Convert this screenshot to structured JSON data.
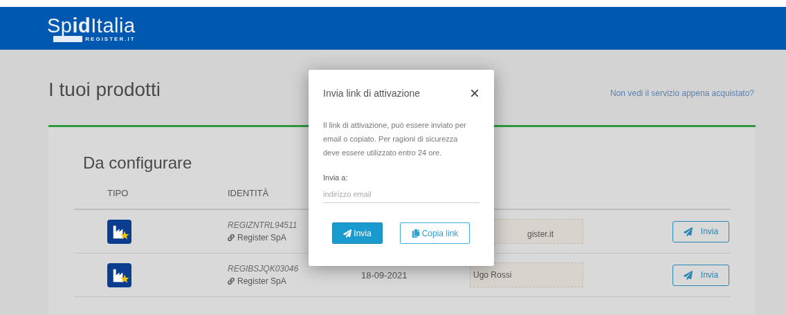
{
  "header": {
    "logo": "Sp**id**Italia",
    "logo_sub": "REGISTER.IT"
  },
  "page": {
    "title": "I tuoi prodotti",
    "help_link": "Non vedi il servizio appena acquistato?"
  },
  "section": {
    "title": "Da configurare",
    "columns": [
      "TIPO",
      "IDENTITÀ"
    ],
    "rows": [
      {
        "code": "REGIZNTRL94511",
        "owner": "Register SpA",
        "name": "gister.it",
        "partly_covered": true,
        "button": "Invia"
      },
      {
        "code": "REGIBSJQK03046",
        "owner": "Register SpA",
        "date": "18-09-2021",
        "name": "Ugo Rossi",
        "partly_covered": false,
        "button": "Invia"
      }
    ]
  },
  "dialog": {
    "title": "Invia link di attivazione",
    "close": "×",
    "text": "Il link di attivazione, può essere inviato per email o copiato. Per ragioni di sicurezza deve essere utilizzato entro 24 ore.",
    "field_label": "Invia a:",
    "placeholder": "indirizzo email",
    "send_button": "Invia",
    "copy_button": "Copia link"
  }
}
